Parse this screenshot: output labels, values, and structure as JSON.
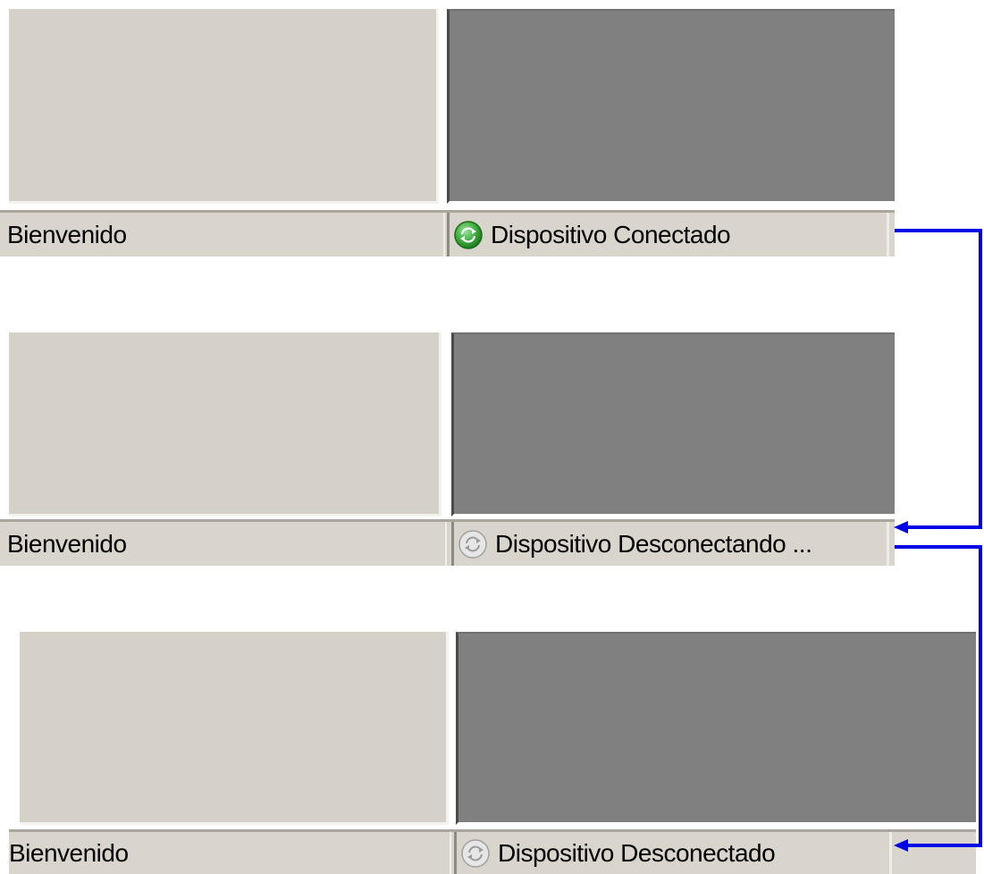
{
  "panels": [
    {
      "status_left": "Bienvenido",
      "status_right": "Dispositivo Conectado",
      "status_icon": "connected-refresh-icon",
      "icon_color": "#3cae3c"
    },
    {
      "status_left": "Bienvenido",
      "status_right": "Dispositivo Desconectando ...",
      "status_icon": "disconnecting-refresh-icon",
      "icon_color": "#bdbdbd"
    },
    {
      "status_left": "Bienvenido",
      "status_right": "Dispositivo Desconectado",
      "status_icon": "disconnected-refresh-icon",
      "icon_color": "#bdbdbd"
    }
  ],
  "colors": {
    "window_bg": "#d5d1c9",
    "dark_pane": "#808080",
    "arrow": "#0000e6"
  }
}
